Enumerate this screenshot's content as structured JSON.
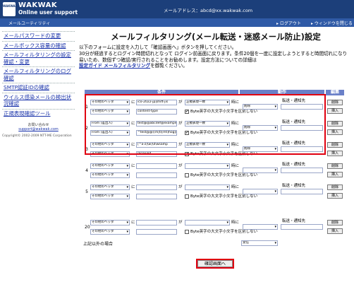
{
  "header": {
    "logo_text": "WAKWAK",
    "brand_line1": "WAKWAK",
    "brand_line2": "Online user support",
    "mail_address": "メールアドレス：abcd@xx.wakwak.com",
    "section_title": "メールユーティリティ",
    "logout_label": "ログアウト",
    "close_window_label": "ウィンドウを閉じる"
  },
  "sidebar": {
    "items": [
      {
        "label": "メールパスワードの変更"
      },
      {
        "label": "メールボックス容量の確認"
      },
      {
        "label": "メールフィルタリングの設定確認・変更"
      },
      {
        "label": "メールフィルタリングのログ確認"
      },
      {
        "label": "SMTP認証IDの確認"
      },
      {
        "label": "ウイルス感染メールの検出状況確認"
      },
      {
        "label": "正規表現確認ツール"
      }
    ],
    "contact_label": "お問い合わせ",
    "contact_mail": "support@wakwak.com",
    "copyright": "Copyright© 2002-2009 NTT-ME Corporation"
  },
  "main": {
    "title": "メールフィルタリング(メール転送・迷惑メール防止)設定",
    "intro_1": "以下のフォームに設定を入力して「確認画面へ」ボタンを押してください。",
    "intro_2": "30分が経過するとログイン時間切れとなって  ログイン前画面に戻ります。条件20個を一度に設定しようとすると時間切れになり易いため、数個ずつ確認/実行されることをお勧めします。設定方法についての詳細は",
    "intro_link": "設定ガイド メールフィルタリング",
    "intro_3": "を御覧ください。",
    "col_condition": "条件",
    "col_action": "動作",
    "col_edit": "編集",
    "ni": "に",
    "ga": "が",
    "toki": "時に",
    "case_label": "Byte英字の大文字小文字を区別しない",
    "delete_label": "削除",
    "insert_label": "挿入",
    "forward_label": "転送・通知先",
    "rows": [
      {
        "num": "1",
        "header": "その他のヘッダ",
        "field": "ico-2022-jp|shift-jis",
        "match": "正規表現一致",
        "header2": "その他のヘッダ",
        "value2": "content-type",
        "match2": "正規表現一致",
        "checked": "✔",
        "action": "削除"
      },
      {
        "num": "2",
        "header": "From (差出人)",
        "field": "test@@abcdef@example.",
        "match": "正規表現一致",
        "header2": "From (差出人)",
        "value2": "^test@@((m|t)[mt]hog|sample)",
        "match2": "正規表現一致",
        "checked": "✔",
        "action": "削除"
      },
      {
        "num": "3",
        "header": "その他のヘッダ",
        "field": "[^a-z]\\w]\\d\\wsamp",
        "match": "正規表現一致",
        "header2": "その他のヘッダ",
        "value2": "received",
        "match2": "正規表現一致",
        "checked": "✔",
        "action": "削除"
      },
      {
        "num": "4",
        "header": "その他のヘッダ",
        "field": "",
        "match": "",
        "header2": "その他のヘッダ",
        "value2": "",
        "match2": "",
        "checked": "",
        "action": ""
      },
      {
        "num": "5",
        "header": "その他のヘッダ",
        "field": "",
        "match": "",
        "header2": "その他のヘッダ",
        "value2": "",
        "match2": "",
        "checked": "",
        "action": ""
      },
      {
        "num": "20",
        "header": "その他のヘッダ",
        "field": "",
        "match": "",
        "header2": "その他のヘッダ",
        "value2": "",
        "match2": "",
        "checked": "",
        "action": ""
      }
    ],
    "other_label": "上記以外の場合",
    "other_action": "受信",
    "submit_label": "確認画面へ"
  },
  "colors": {
    "header_bg": "#1c3f7a",
    "table_header": "#6a80c8",
    "highlight": "#e00010"
  }
}
